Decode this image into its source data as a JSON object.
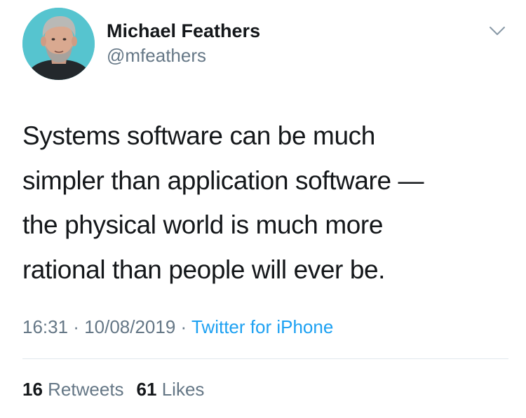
{
  "author": {
    "display_name": "Michael Feathers",
    "handle": "@mfeathers"
  },
  "icons": {
    "menu": "chevron-down-icon",
    "avatar": "profile-photo"
  },
  "tweet": {
    "text": "Systems software can be much\nsimpler than application software —\nthe physical world is much more\nrational than people will ever be."
  },
  "meta": {
    "time": "16:31",
    "separator1": " · ",
    "date": "10/08/2019",
    "separator2": " · ",
    "source": "Twitter for iPhone"
  },
  "stats": {
    "retweets_count": "16",
    "retweets_label": "Retweets",
    "likes_count": "61",
    "likes_label": "Likes"
  },
  "colors": {
    "accent": "#1da1f2",
    "text": "#14171a",
    "secondary": "#657786",
    "divider": "#e1e8ed"
  }
}
